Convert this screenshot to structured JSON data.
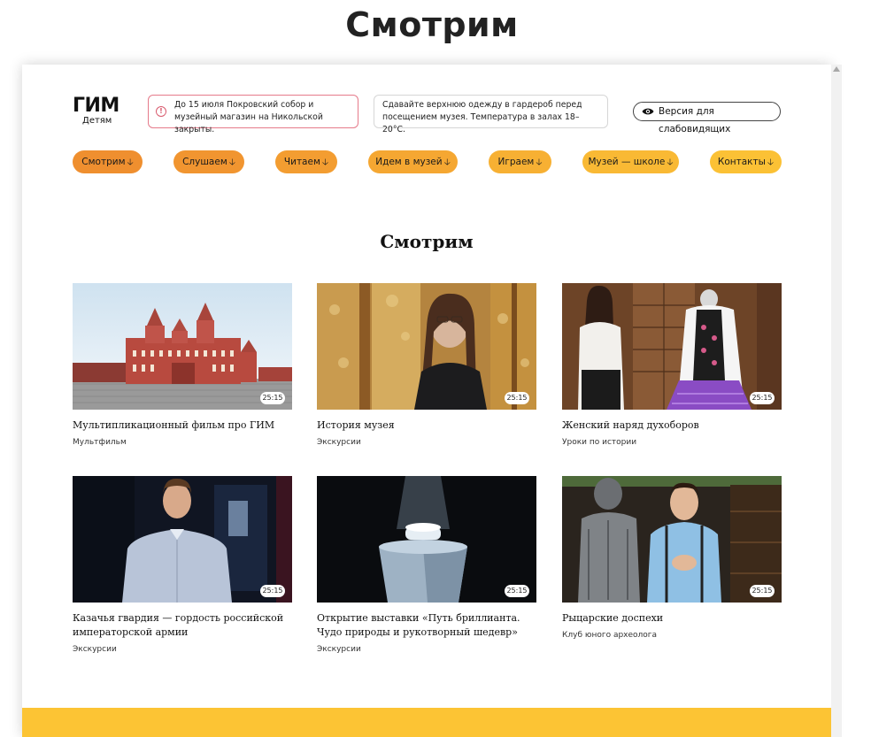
{
  "outer_title": "Смотрим",
  "logo": {
    "big": "ГИМ",
    "small": "Детям"
  },
  "notices": {
    "alert": "До 15 июля Покровский собор и музейный магазин на Никольской закрыты.",
    "info": "Сдавайте верхнюю одежду в гардероб перед посещением музея. Температура в залах 18–20°С."
  },
  "accessibility_button": "Версия для слабовидящих",
  "nav": [
    {
      "label": "Смотрим",
      "color": "#ef8f2f"
    },
    {
      "label": "Слушаем",
      "color": "#f19530"
    },
    {
      "label": "Читаем",
      "color": "#f39d31"
    },
    {
      "label": "Идем в музей",
      "color": "#f5a732"
    },
    {
      "label": "Играем",
      "color": "#f7b033"
    },
    {
      "label": "Музей — школе",
      "color": "#f9b934"
    },
    {
      "label": "Контакты",
      "color": "#fbc135"
    }
  ],
  "nav_arrow": "🡣",
  "section_title": "Смотрим",
  "videos": [
    {
      "title": "Мультипликационный фильм про ГИМ",
      "category": "Мультфильм",
      "duration": "25:15"
    },
    {
      "title": "История музея",
      "category": "Экскурсии",
      "duration": "25:15"
    },
    {
      "title": "Женский наряд духоборов",
      "category": "Уроки по истории",
      "duration": "25:15"
    },
    {
      "title": "Казачья гвардия — гордость российской императорской армии",
      "category": "Экскурсии",
      "duration": "25:15"
    },
    {
      "title": "Открытие выставки «Путь бриллианта. Чудо природы и рукотворный шедевр»",
      "category": "Экскурсии",
      "duration": "25:15"
    },
    {
      "title": "Рыцарские доспехи",
      "category": "Клуб юного археолога",
      "duration": "25:15"
    }
  ],
  "colors": {
    "accent_orange": "#ef8f2f",
    "accent_yellow": "#fcc434",
    "alert_border": "#e57a8a"
  }
}
